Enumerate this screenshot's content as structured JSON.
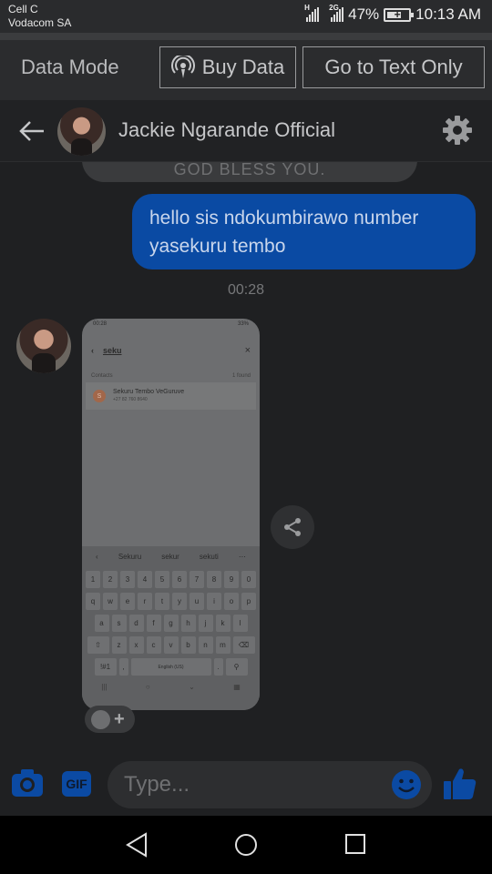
{
  "status_bar": {
    "carrier_line1": "Cell C",
    "carrier_line2": "Vodacom SA",
    "network_1": "H",
    "network_2": "2G",
    "battery_percent": "47%",
    "time": "10:13 AM"
  },
  "data_bar": {
    "mode_label": "Data Mode",
    "buy_label": "Buy Data",
    "text_only_label": "Go to Text Only"
  },
  "header": {
    "contact_name": "Jackie Ngarande Official"
  },
  "messages": {
    "previous_partial": "GOD BLESS YOU.",
    "outgoing_text": "hello sis ndokumbirawo number yasekuru tembo",
    "timestamp": "00:28"
  },
  "shared_screenshot": {
    "time": "00:28",
    "battery": "33%",
    "search_query": "seku",
    "contacts_label": "Contacts",
    "found_label": "1 found",
    "result_initial": "S",
    "result_name": "Sekuru Tembo VeGuruve",
    "result_number": "+27 82 760 8640",
    "suggestions": [
      "Sekuru",
      "sekur",
      "sekuti"
    ],
    "row1": [
      "1",
      "2",
      "3",
      "4",
      "5",
      "6",
      "7",
      "8",
      "9",
      "0"
    ],
    "row2": [
      "q",
      "w",
      "e",
      "r",
      "t",
      "y",
      "u",
      "i",
      "o",
      "p"
    ],
    "row3": [
      "a",
      "s",
      "d",
      "f",
      "g",
      "h",
      "j",
      "k",
      "l"
    ],
    "row4": [
      "z",
      "x",
      "c",
      "v",
      "b",
      "n",
      "m"
    ],
    "symbols_key": "!#1",
    "comma_key": ",",
    "space_key": "English (US)",
    "period_key": "."
  },
  "composer": {
    "gif_label": "GIF",
    "placeholder": "Type..."
  },
  "colors": {
    "accent_blue": "#0b4aa3",
    "outgoing_bubble": "#0a4aa3"
  }
}
